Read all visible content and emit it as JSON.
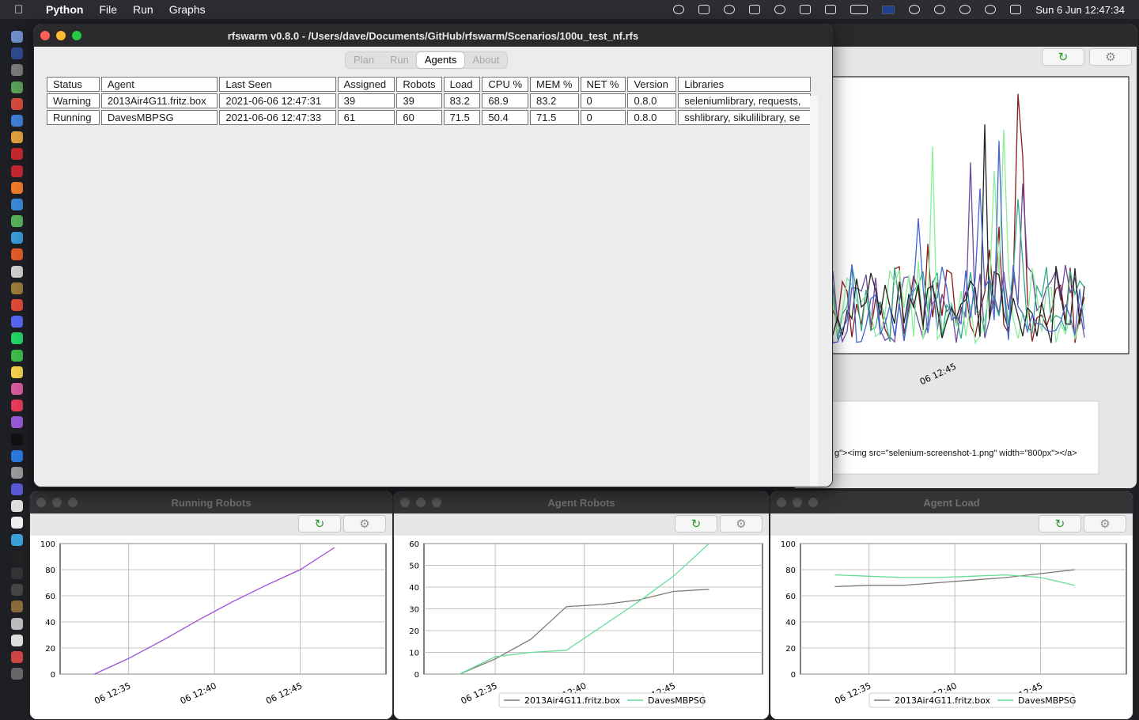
{
  "menubar": {
    "apple_icon": "apple-icon",
    "app_name": "Python",
    "menus": [
      "File",
      "Run",
      "Graphs"
    ],
    "clock": "Sun 6 Jun  12:47:34"
  },
  "main_window": {
    "title": "rfswarm v0.8.0 - /Users/dave/Documents/GitHub/rfswarm/Scenarios/100u_test_nf.rfs",
    "tabs": [
      "Plan",
      "Run",
      "Agents",
      "About"
    ],
    "active_tab": "Agents",
    "table": {
      "columns": [
        "Status",
        "Agent",
        "Last Seen",
        "Assigned",
        "Robots",
        "Load",
        "CPU %",
        "MEM %",
        "NET %",
        "Version",
        "Libraries"
      ],
      "rows": [
        [
          "Warning",
          "2013Air4G11.fritz.box",
          "2021-06-06 12:47:31",
          "39",
          "39",
          "83.2",
          "68.9",
          "83.2",
          "0",
          "0.8.0",
          "seleniumlibrary, requests,"
        ],
        [
          "Running",
          "DavesMBPSG",
          "2021-06-06 12:47:33",
          "61",
          "60",
          "71.5",
          "50.4",
          "71.5",
          "0",
          "0.8.0",
          "sshlibrary, sikulilibrary, se"
        ]
      ]
    }
  },
  "right_window": {
    "xtick": "06 12:45",
    "log_text": "g\"><img src=\"selenium-screenshot-1.png\" width=\"800px\"></a>"
  },
  "colors": {
    "purple": "#9b4fd6",
    "gray": "#807870",
    "green": "#66dd99",
    "accent": "#2e9a2e"
  },
  "chart_data": [
    {
      "title": "Running Robots",
      "type": "line",
      "ylim": [
        0,
        100
      ],
      "yticks": [
        0,
        20,
        40,
        60,
        80,
        100
      ],
      "xticks": [
        "06 12:35",
        "06 12:40",
        "06 12:45"
      ],
      "grid": true,
      "series": [
        {
          "x": [
            "12:33",
            "12:35",
            "12:37",
            "12:39",
            "12:41",
            "12:43",
            "12:45",
            "12:47"
          ],
          "values": [
            0,
            12,
            26,
            41,
            55,
            68,
            80,
            97
          ]
        }
      ]
    },
    {
      "title": "Agent Robots",
      "type": "line",
      "ylim": [
        0,
        60
      ],
      "yticks": [
        0,
        10,
        20,
        30,
        40,
        50,
        60
      ],
      "xticks": [
        "06 12:35",
        "06 12:40",
        "06 12:45"
      ],
      "grid": true,
      "legend": "bottom-center",
      "series": [
        {
          "name": "2013Air4G11.fritz.box",
          "x": [
            "12:33",
            "12:35",
            "12:37",
            "12:39",
            "12:41",
            "12:43",
            "12:45",
            "12:47"
          ],
          "values": [
            0,
            7,
            16,
            31,
            32,
            34,
            38,
            39
          ]
        },
        {
          "name": "DavesMBPSG",
          "x": [
            "12:33",
            "12:35",
            "12:37",
            "12:39",
            "12:41",
            "12:43",
            "12:45",
            "12:47"
          ],
          "values": [
            0,
            8,
            10,
            11,
            22,
            33,
            45,
            60
          ]
        }
      ]
    },
    {
      "title": "Agent Load",
      "type": "line",
      "ylim": [
        0,
        100
      ],
      "yticks": [
        0,
        20,
        40,
        60,
        80,
        100
      ],
      "xticks": [
        "06 12:35",
        "06 12:40",
        "06 12:45"
      ],
      "grid": true,
      "legend": "bottom-center",
      "series": [
        {
          "name": "2013Air4G11.fritz.box",
          "x": [
            "12:33",
            "12:35",
            "12:37",
            "12:39",
            "12:41",
            "12:43",
            "12:45",
            "12:47"
          ],
          "values": [
            67,
            68,
            68,
            70,
            72,
            74,
            77,
            80
          ]
        },
        {
          "name": "DavesMBPSG",
          "x": [
            "12:33",
            "12:35",
            "12:37",
            "12:39",
            "12:41",
            "12:43",
            "12:45",
            "12:47"
          ],
          "values": [
            76,
            75,
            74,
            74,
            75,
            76,
            74,
            68
          ]
        }
      ]
    }
  ]
}
